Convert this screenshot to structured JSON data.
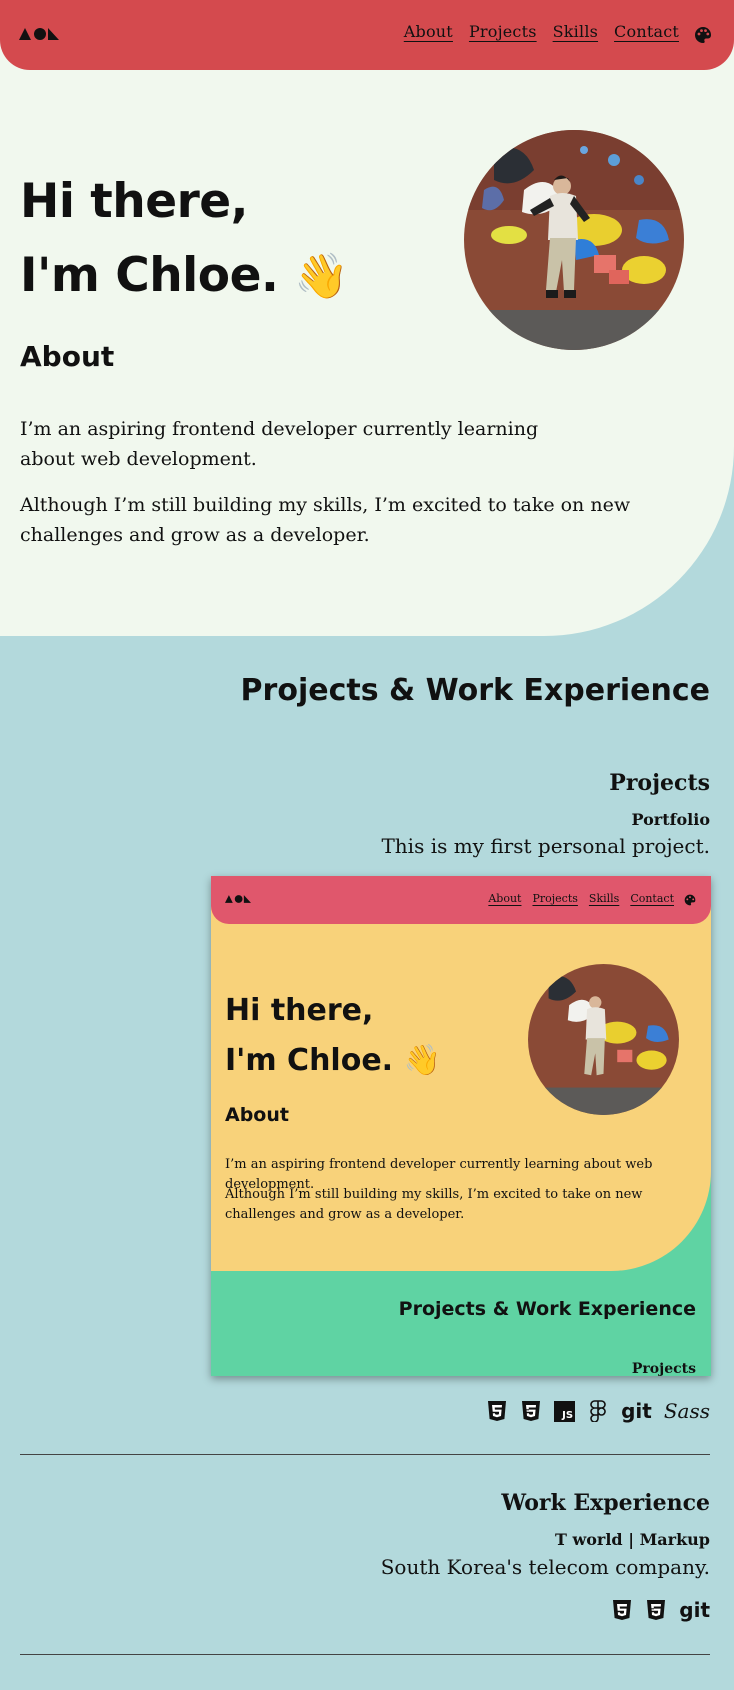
{
  "nav": {
    "links": [
      "About",
      "Projects",
      "Skills",
      "Contact"
    ]
  },
  "hero": {
    "greeting_line1": "Hi there,",
    "greeting_line2": "I'm Chloe.",
    "wave_emoji": "👋",
    "about_heading": "About",
    "about_paragraph1": "I’m an aspiring frontend developer currently learning about web development.",
    "about_paragraph2": "Although I’m still building my skills, I’m excited to take on new challenges and grow as a developer."
  },
  "projects_section": {
    "title": "Projects & Work Experience",
    "projects_heading": "Projects",
    "project": {
      "name": "Portfolio",
      "description": "This is my first personal project.",
      "tech": [
        "html5-icon",
        "css3-icon",
        "javascript-icon",
        "figma-icon",
        "git-icon",
        "sass-icon"
      ],
      "tech_labels": {
        "js": "JS",
        "git": "git",
        "sass": "Sass"
      }
    },
    "work_heading": "Work Experience",
    "work": {
      "name": "T world | Markup",
      "description": "South Korea's telecom company.",
      "tech": [
        "html5-icon",
        "css3-icon",
        "git-icon"
      ],
      "tech_labels": {
        "git": "git"
      }
    }
  },
  "preview": {
    "nav_links": [
      "About",
      "Projects",
      "Skills",
      "Contact"
    ],
    "greeting_line1": "Hi there,",
    "greeting_line2": "I'm Chloe.",
    "wave_emoji": "👋",
    "about_heading": "About",
    "about_paragraph1": "I’m an aspiring frontend developer currently learning about web development.",
    "about_paragraph2": "Although I’m still building my skills, I’m excited to take on new challenges and grow as a developer.",
    "section_title": "Projects & Work Experience",
    "projects_heading": "Projects"
  },
  "colors": {
    "nav": "#d44a4e",
    "hero_bg": "#f1f8ee",
    "section_bg": "#b3d9dc",
    "preview_nav": "#e0576c",
    "preview_hero": "#f8d27a",
    "preview_section": "#5fd3a3"
  }
}
